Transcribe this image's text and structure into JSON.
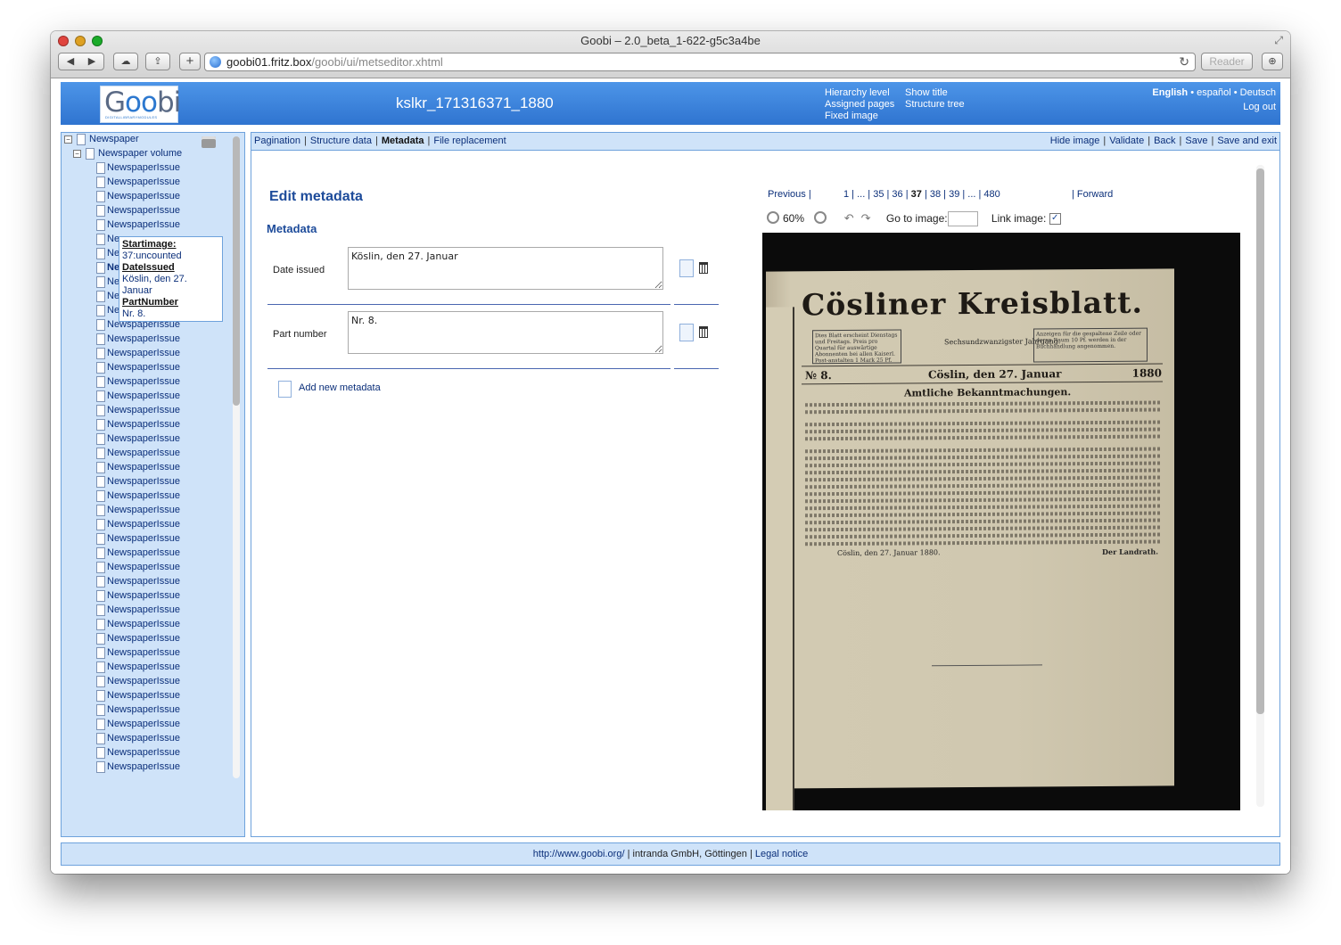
{
  "browser": {
    "window_title": "Goobi – 2.0_beta_1-622-g5c3a4be",
    "url_host": "goobi01.fritz.box",
    "url_path": "/goobi/ui/metseditor.xhtml",
    "reader_label": "Reader"
  },
  "header": {
    "logo_text_g": "G",
    "logo_text_oo": "oo",
    "logo_text_bi": "bi",
    "logo_subtitle": "DIGITALLIBRARYMODULES",
    "doc_title": "kslkr_171316371_1880",
    "view_links": [
      "Hierarchy level",
      "Show title",
      "Assigned pages",
      "Structure tree",
      "Fixed image"
    ],
    "languages": [
      "English",
      "español",
      "Deutsch"
    ],
    "logout": "Log out"
  },
  "tree": {
    "root": "Newspaper",
    "volume": "Newspaper volume",
    "issue_label": "NewspaperIssue",
    "issue_label_partial": "Ne",
    "issue_count": 43
  },
  "tooltip": {
    "k1": "Startimage:",
    "v1": "37:uncounted",
    "k2": "DateIssued",
    "v2": "Köslin, den 27. Januar",
    "k3": "PartNumber",
    "v3": "Nr. 8."
  },
  "tabs": {
    "pagination": "Pagination",
    "structure": "Structure data",
    "metadata": "Metadata",
    "file_replacement": "File replacement",
    "hide_image": "Hide image",
    "validate": "Validate",
    "back": "Back",
    "save": "Save",
    "save_exit": "Save and exit"
  },
  "editor": {
    "title": "Edit metadata",
    "heading": "Metadata",
    "fields": [
      {
        "label": "Date issued",
        "value": "Köslin, den 27. Januar"
      },
      {
        "label": "Part number",
        "value": "Nr. 8."
      }
    ],
    "add_label": "Add new metadata"
  },
  "image_nav": {
    "previous": "Previous",
    "pages_before": "1 | ... | 35 | 36 |",
    "current": "37",
    "pages_after": "| 38 | 39 | ... | 480",
    "forward": "| Forward",
    "zoom": "60%",
    "goto_label": "Go to image:",
    "link_label": "Link image:",
    "link_checked": true
  },
  "scan": {
    "title": "Cösliner Kreisblatt.",
    "box_left": "Dies Blatt erscheint Dienstags und Freitags. Preis pro Quartal für auswärtige Abonnenten bei allen Kaiserl. Post-anstalten 1 Mark 25 Pf.",
    "jahrgang": "Sechsundzwanzigster Jahrgang.",
    "box_right": "Anzeigen für die gespaltene Zeile oder deren Raum 10 Pf. werden in der Buchhandlung angenommen.",
    "nr": "№ 8.",
    "date": "Cöslin, den 27. Januar",
    "year": "1880",
    "heading": "Amtliche Bekanntmachungen.",
    "sign_left": "Cöslin, den 27. Januar 1880.",
    "sign_right": "Der Landrath."
  },
  "footer": {
    "url": "http://www.goobi.org/",
    "company": "intranda GmbH, Göttingen",
    "legal": "Legal notice"
  }
}
